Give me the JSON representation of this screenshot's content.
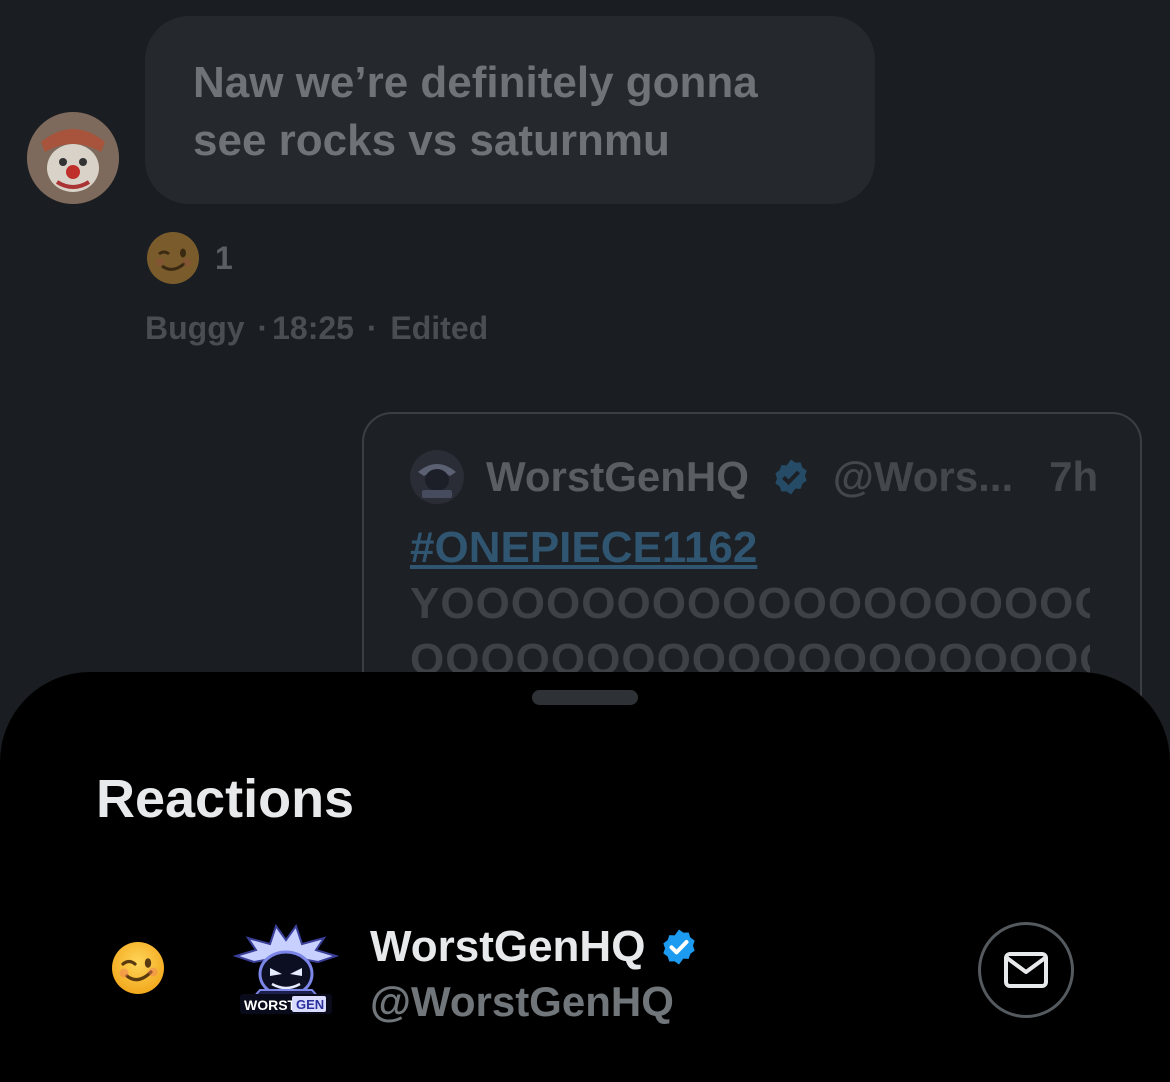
{
  "message": {
    "text": "Naw we’re definitely gonna\nsee rocks vs saturnmu",
    "reaction_emoji": "winking-face",
    "reaction_count": "1",
    "sender": "Buggy",
    "separator1": "·",
    "time": "18:25",
    "separator2": "·",
    "edited_label": "Edited"
  },
  "quoted_post": {
    "author_name": "WorstGenHQ",
    "verified": true,
    "handle": "@Wors...",
    "age": "7h",
    "hashtag": "#ONEPIECE1162",
    "line1": "YOOOOOOOOOOOOOOOOOOOO",
    "line2": "OOOOOOOOOOOOOOOOOOOOOO"
  },
  "sheet": {
    "title": "Reactions",
    "reactions": [
      {
        "emoji": "winking-face",
        "name": "WorstGenHQ",
        "verified": true,
        "handle": "@WorstGenHQ",
        "action_icon": "envelope-icon"
      }
    ]
  },
  "logo_text": {
    "worst": "WORST",
    "gen": "GEN"
  },
  "colors": {
    "background": "#1a1d21",
    "sheet": "#000000",
    "verified": "#1d9bf0",
    "hashtag": "#305570"
  }
}
